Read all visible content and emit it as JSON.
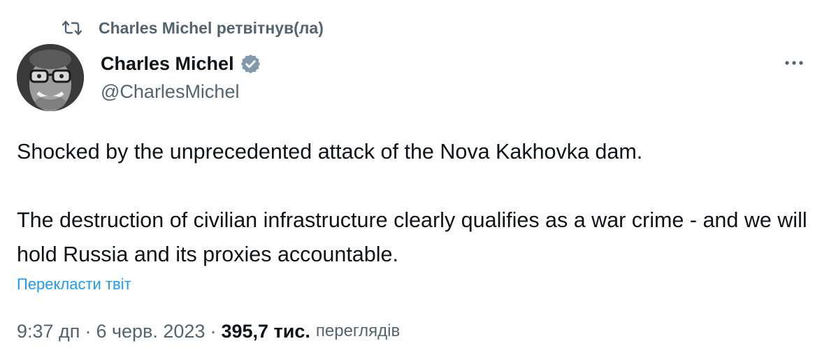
{
  "retweet": {
    "icon": "retweet-icon",
    "text": "Charles Michel ретвітнув(ла)"
  },
  "author": {
    "name": "Charles Michel",
    "handle": "@CharlesMichel",
    "verified": true,
    "verified_color": "#829aab"
  },
  "more_icon": "more-dots-icon",
  "tweet": {
    "text": "Shocked by the unprecedented attack of the Nova Kakhovka dam.\n\nThe destruction of civilian infrastructure clearly qualifies as a war crime - and we will hold Russia and its proxies accountable."
  },
  "translate_label": "Перекласти твіт",
  "meta": {
    "time": "9:37 дп",
    "separator": "·",
    "date": "6 черв. 2023",
    "views_count": "395,7 тис.",
    "views_label": "переглядів"
  },
  "colors": {
    "link": "#1d9bf0",
    "secondary_text": "#536471",
    "primary_text": "#0f1419"
  }
}
